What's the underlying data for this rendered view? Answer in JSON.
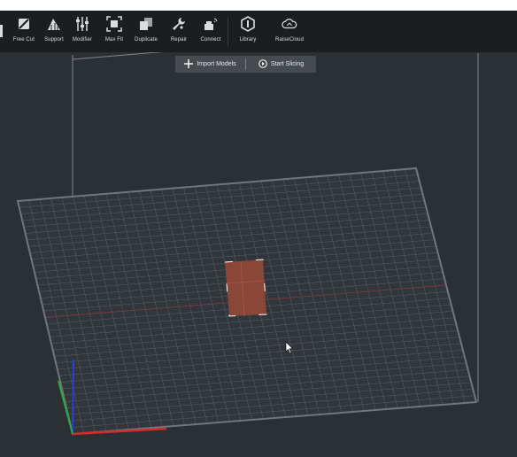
{
  "toolbar": {
    "items": [
      {
        "label": "Free Cut",
        "icon": "free-cut-icon"
      },
      {
        "label": "Support",
        "icon": "support-icon"
      },
      {
        "label": "Modifier",
        "icon": "modifier-icon"
      },
      {
        "label": "Max Fit",
        "icon": "max-fit-icon"
      },
      {
        "label": "Duplicate",
        "icon": "duplicate-icon"
      },
      {
        "label": "Repair",
        "icon": "repair-icon"
      },
      {
        "label": "Connect",
        "icon": "connect-icon"
      },
      {
        "label": "Library",
        "icon": "library-icon"
      },
      {
        "label": "RaiseCloud",
        "icon": "cloud-icon"
      }
    ]
  },
  "actions": {
    "import_label": "Import Models",
    "slice_label": "Start Slicing"
  },
  "colors": {
    "toolbar_bg": "#1b1e21",
    "viewport_bg": "#2b3034",
    "grid": "#5b6065",
    "model": "#8a4637",
    "axis_x": "#d32a2a",
    "axis_y": "#2fa83c",
    "axis_z": "#2243d8"
  }
}
